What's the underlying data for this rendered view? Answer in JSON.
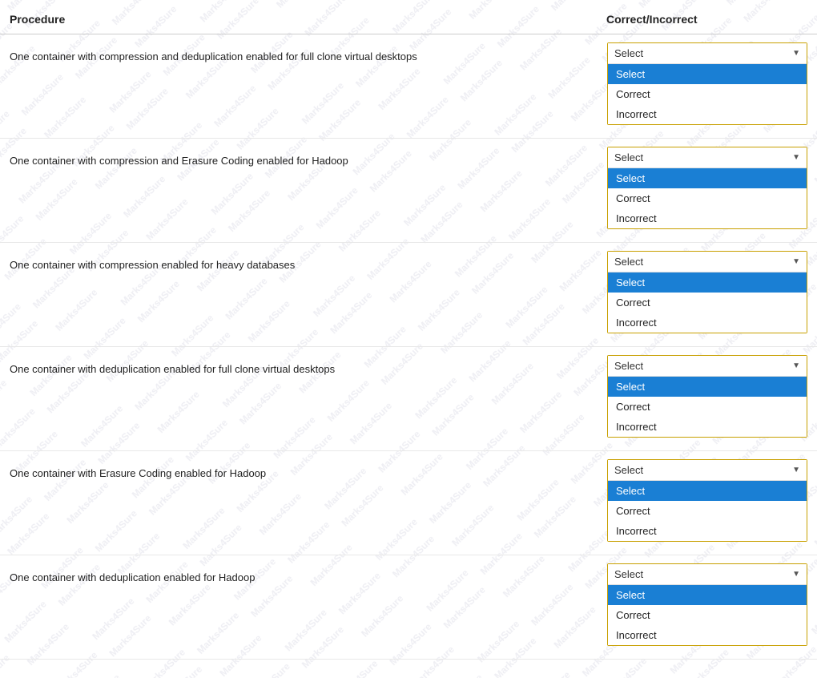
{
  "header": {
    "procedure_label": "Procedure",
    "correct_incorrect_label": "Correct/Incorrect"
  },
  "rows": [
    {
      "id": 1,
      "procedure_text": "One container with compression and deduplication enabled for full clone virtual desktops",
      "dropdown": {
        "selected": "Select",
        "options": [
          "Select",
          "Correct",
          "Incorrect"
        ]
      }
    },
    {
      "id": 2,
      "procedure_text": "One container with compression and Erasure Coding enabled for Hadoop",
      "dropdown": {
        "selected": "Select",
        "options": [
          "Select",
          "Correct",
          "Incorrect"
        ]
      }
    },
    {
      "id": 3,
      "procedure_text": "One container with compression enabled for heavy databases",
      "dropdown": {
        "selected": "Select",
        "options": [
          "Select",
          "Correct",
          "Incorrect"
        ]
      }
    },
    {
      "id": 4,
      "procedure_text": "One container with deduplication enabled for full clone virtual desktops",
      "dropdown": {
        "selected": "Select",
        "options": [
          "Select",
          "Correct",
          "Incorrect"
        ]
      }
    },
    {
      "id": 5,
      "procedure_text": "One container with Erasure Coding enabled for Hadoop",
      "dropdown": {
        "selected": "Select",
        "options": [
          "Select",
          "Correct",
          "Incorrect"
        ]
      }
    },
    {
      "id": 6,
      "procedure_text": "One container with deduplication enabled for Hadoop",
      "dropdown": {
        "selected": "Select",
        "options": [
          "Select",
          "Correct",
          "Incorrect"
        ]
      }
    }
  ],
  "watermark": {
    "text": "Marks4Sure"
  }
}
